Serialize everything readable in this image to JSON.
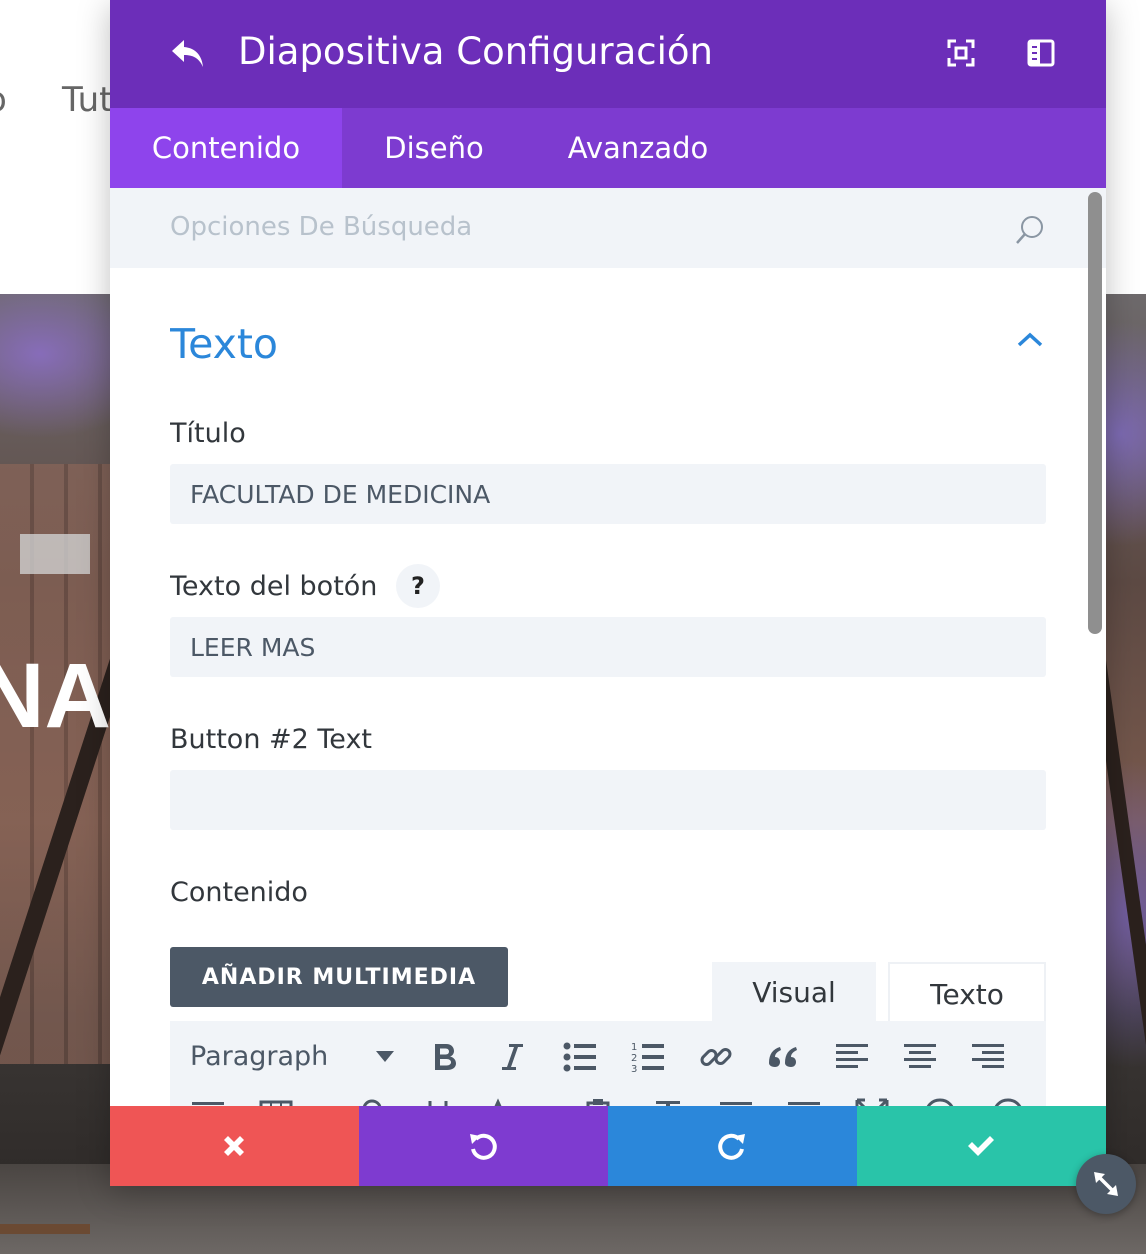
{
  "background": {
    "nav_left": "o",
    "nav_item": "Tut",
    "hero_text": "NA"
  },
  "header": {
    "title": "Diapositiva Configuración",
    "icons": [
      "undo-arrow-icon",
      "focus-mode-icon",
      "sidebar-layout-icon"
    ]
  },
  "tabs": [
    {
      "label": "Contenido",
      "active": true
    },
    {
      "label": "Diseño",
      "active": false
    },
    {
      "label": "Avanzado",
      "active": false
    }
  ],
  "search": {
    "placeholder": "Opciones De Búsqueda"
  },
  "section": {
    "title": "Texto"
  },
  "fields": {
    "title_label": "Título",
    "title_value": "FACULTAD DE MEDICINA",
    "button_label": "Texto del botón",
    "help": "?",
    "button_value": "LEER MAS",
    "button2_label": "Button #2 Text",
    "button2_value": "",
    "content_label": "Contenido"
  },
  "editor": {
    "media_button": "AÑADIR MULTIMEDIA",
    "tab_visual": "Visual",
    "tab_text": "Texto",
    "format": "Paragraph",
    "active_tab": "Visual"
  },
  "colors": {
    "header": "#6c2eb9",
    "tabs": "#7d3bd0",
    "tab_active": "#8e44ec",
    "accent_blue": "#2b87da",
    "cancel": "#ef5555",
    "undo": "#7e3bd0",
    "redo": "#2b87da",
    "save": "#29c4a9"
  }
}
